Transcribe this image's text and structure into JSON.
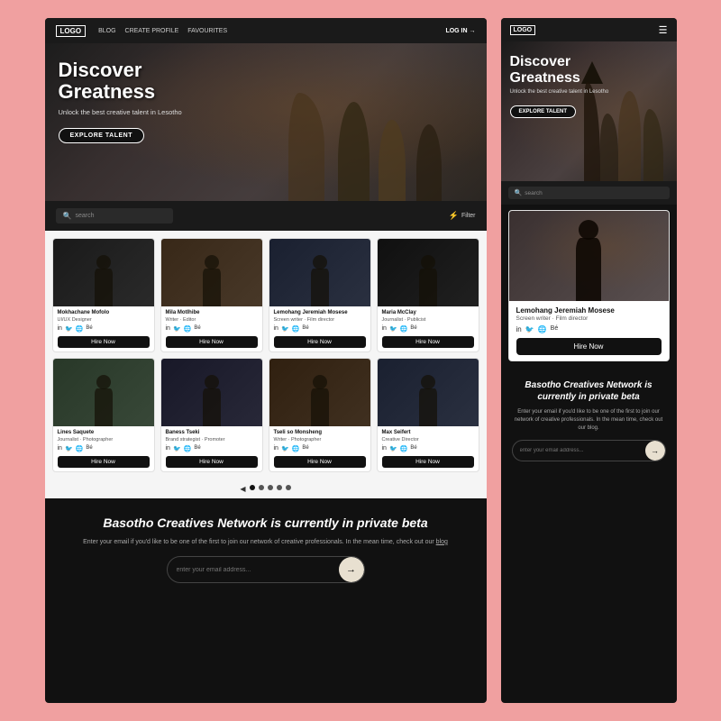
{
  "desktop": {
    "nav": {
      "logo": "LOGO",
      "links": [
        "BLOG",
        "CREATE PROFILE",
        "FAVOURITES"
      ],
      "login": "LOG IN →"
    },
    "hero": {
      "title_line1": "Discover",
      "title_line2": "Greatness",
      "subtitle": "Unlock the best creative talent in Lesotho",
      "cta": "EXPLORE TALENT"
    },
    "search": {
      "placeholder": "search",
      "filter_label": "Filter"
    },
    "cards_row1": [
      {
        "name": "Mokhachane Mofolo",
        "role": "UI/UX Designer"
      },
      {
        "name": "Mila Motlhibe",
        "role": "Writer · Editor"
      },
      {
        "name": "Lemohang Jeremiah Mosese",
        "role": "Screen writer · Film director"
      },
      {
        "name": "Maria McClay",
        "role": "Journalist · Publicist"
      }
    ],
    "cards_row2": [
      {
        "name": "Lines Saquete",
        "role": "Journalist · Photographer"
      },
      {
        "name": "Baness Tseki",
        "role": "Brand strategist · Promoter"
      },
      {
        "name": "Tseli so Monsheng",
        "role": "Writer · Photographer"
      },
      {
        "name": "Max Seifert",
        "role": "Creative Director"
      }
    ],
    "hire_btn": "Hire Now",
    "beta": {
      "title": "Basotho Creatives Network is currently in private beta",
      "description": "Enter your email if you'd like to be one of the first to join our network of creative professionals. In the mean time, check out our",
      "link_text": "blog",
      "email_placeholder": "enter your email address..."
    }
  },
  "mobile": {
    "nav": {
      "logo": "LOGO"
    },
    "hero": {
      "title_line1": "Discover",
      "title_line2": "Greatness",
      "subtitle": "Unlock the best creative talent in Lesotho",
      "cta": "EXPLORE TALENT"
    },
    "search": {
      "placeholder": "search"
    },
    "featured_card": {
      "name": "Lemohang Jeremiah Mosese",
      "role": "Screen writer · Film director"
    },
    "hire_btn": "Hire Now",
    "beta": {
      "title": "Basotho Creatives Network is currently in private beta",
      "description": "Enter your email if you'd like to be one of the first to join our network of creative professionals. In the mean time, check out our blog.",
      "email_placeholder": "enter your email address..."
    }
  },
  "social_icons": [
    "in",
    "🐦",
    "🌐",
    "Bé"
  ]
}
